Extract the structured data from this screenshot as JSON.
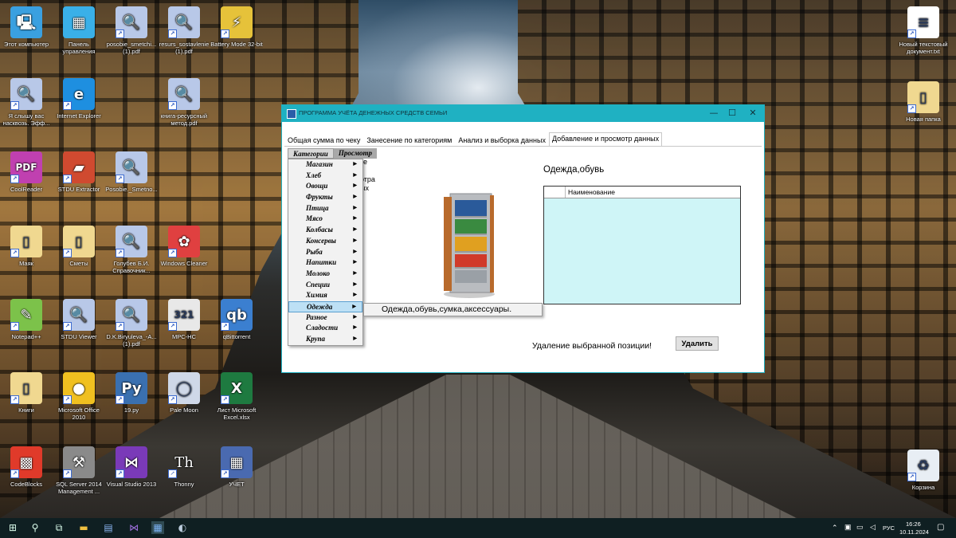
{
  "desktop": {
    "icons": [
      {
        "label": "Этот компьютер",
        "icon": "computer-icon",
        "color": "#3aa0e0"
      },
      {
        "label": "Панель управления",
        "icon": "control-panel-icon",
        "color": "#3ab0e8"
      },
      {
        "label": "posobie_smetchi...(1).pdf",
        "icon": "pdf-search-icon",
        "color": "#b8c8e8"
      },
      {
        "label": "resurs_sostavlenie (1).pdf",
        "icon": "pdf-search-icon",
        "color": "#b8c8e8"
      },
      {
        "label": "Battery Mode 32-bit",
        "icon": "battery-icon",
        "color": "#e6c23a"
      },
      {
        "label": "Я слышу вас насквозь. Эфф...",
        "icon": "pdf-search-icon",
        "color": "#b8c8e8"
      },
      {
        "label": "Internet Explorer",
        "icon": "ie-icon",
        "color": "#1e8fe0"
      },
      {
        "label": "книга-ресурсный метод.pdf",
        "icon": "pdf-search-icon",
        "color": "#b8c8e8"
      },
      {
        "label": "CoolReader",
        "icon": "pdf-reader-icon",
        "color": "#c040b0"
      },
      {
        "label": "STDU Extractor",
        "icon": "extractor-icon",
        "color": "#d04a30"
      },
      {
        "label": "Posobie._Smetno...",
        "icon": "pdf-search-icon",
        "color": "#b8c8e8"
      },
      {
        "label": "Маяк",
        "icon": "folder-icon",
        "color": "#f0d890"
      },
      {
        "label": "Сметы",
        "icon": "folder-icon",
        "color": "#f0d890"
      },
      {
        "label": "Голубев Б.И. Справочник...",
        "icon": "pdf-search-icon",
        "color": "#b8c8e8"
      },
      {
        "label": "Windows Cleaner",
        "icon": "cleaner-icon",
        "color": "#e04040"
      },
      {
        "label": "Notepad++",
        "icon": "notepad-icon",
        "color": "#7cc24a"
      },
      {
        "label": "STDU Viewer",
        "icon": "pdf-search-icon",
        "color": "#b8c8e8"
      },
      {
        "label": "D.K.Biryuleva_-A...(1).pdf",
        "icon": "pdf-search-icon",
        "color": "#b8c8e8"
      },
      {
        "label": "MPC-HC",
        "icon": "mpc-icon",
        "color": "#e8e8e8"
      },
      {
        "label": "qBittorrent",
        "icon": "qbittorrent-icon",
        "color": "#3b7fd0"
      },
      {
        "label": "Книги",
        "icon": "folder-icon",
        "color": "#f0d890"
      },
      {
        "label": "Microsoft Office 2010",
        "icon": "office-icon",
        "color": "#f0c020"
      },
      {
        "label": "19.py",
        "icon": "python-icon",
        "color": "#3a70b0"
      },
      {
        "label": "Pale Moon",
        "icon": "pale-moon-icon",
        "color": "#cfd8e8"
      },
      {
        "label": "Лист Microsoft Excel.xlsx",
        "icon": "excel-icon",
        "color": "#1e7a40"
      },
      {
        "label": "CodeBlocks",
        "icon": "codeblocks-icon",
        "color": "#e03a2a"
      },
      {
        "label": "SQL Server 2014 Management ...",
        "icon": "sql-server-icon",
        "color": "#8a8a8a"
      },
      {
        "label": "Visual Studio 2013",
        "icon": "visual-studio-icon",
        "color": "#7a3ab8"
      },
      {
        "label": "Thonny",
        "icon": "thonny-icon",
        "color": "#ffffff"
      },
      {
        "label": "УЧЕТ",
        "icon": "app-shortcut-icon",
        "color": "#4a6ab0"
      },
      {
        "label": "Новый текстовый документ.txt",
        "icon": "text-file-icon",
        "color": "#ffffff"
      },
      {
        "label": "Новая папка",
        "icon": "folder-icon",
        "color": "#f0d890"
      },
      {
        "label": "Корзина",
        "icon": "recycle-bin-icon",
        "color": "#e8eef4"
      }
    ]
  },
  "window": {
    "title": "ПРОГРАММА УЧЁТА ДЕНЕЖНЫХ СРЕДСТВ СЕМЬИ",
    "minimize": "—",
    "maximize": "☐",
    "close": "✕",
    "tabs": [
      {
        "label": "Общая сумма по чеку",
        "active": false
      },
      {
        "label": "Занесение по категориям",
        "active": false
      },
      {
        "label": "Анализ и выборка данных",
        "active": false
      },
      {
        "label": "Добавление и просмотр данных",
        "active": true
      }
    ],
    "menu": [
      {
        "label": "Категории"
      },
      {
        "label": "Просмотр"
      }
    ],
    "partial_texts": [
      "те",
      "отра",
      "ых"
    ],
    "dropdown": [
      {
        "label": "Магазин",
        "highlighted": false
      },
      {
        "label": "Хлеб",
        "highlighted": false
      },
      {
        "label": "Овощи",
        "highlighted": false
      },
      {
        "label": "Фрукты",
        "highlighted": false
      },
      {
        "label": "Птица",
        "highlighted": false
      },
      {
        "label": "Мясо",
        "highlighted": false
      },
      {
        "label": "Колбасы",
        "highlighted": false
      },
      {
        "label": "Консервы",
        "highlighted": false
      },
      {
        "label": "Рыба",
        "highlighted": false
      },
      {
        "label": "Напитки",
        "highlighted": false
      },
      {
        "label": "Молоко",
        "highlighted": false
      },
      {
        "label": "Специи",
        "highlighted": false
      },
      {
        "label": "Химия",
        "highlighted": false
      },
      {
        "label": "Одежда",
        "highlighted": true
      },
      {
        "label": "Разное",
        "highlighted": false
      },
      {
        "label": "Сладости",
        "highlighted": false
      },
      {
        "label": "Крупа",
        "highlighted": false
      }
    ],
    "submenu_item": "Одежда,обувь,сумка,аксессуары.",
    "category_title": "Одежда,обувь",
    "grid": {
      "column": "Наименование"
    },
    "delete_label": "Удаление выбранной позиции!",
    "delete_button": "Удалить",
    "accent_color": "#1fb1c2"
  },
  "taskbar": {
    "language": "РУС",
    "time": "16:26",
    "date": "10.11.2024"
  }
}
